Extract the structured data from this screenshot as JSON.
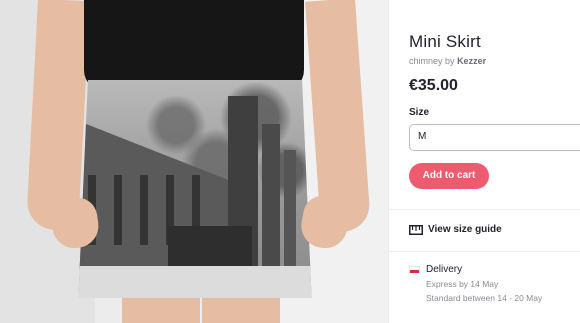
{
  "product": {
    "title": "Mini Skirt",
    "design_name": "chimney",
    "by_label": "by",
    "artist": "Kezzer",
    "price": "€35.00"
  },
  "size": {
    "label": "Size",
    "selected": "M"
  },
  "actions": {
    "add_to_cart": "Add to cart",
    "size_guide": "View size guide"
  },
  "delivery": {
    "title": "Delivery",
    "express": "Express by 14 May",
    "standard": "Standard between 14 - 20 May",
    "flag_icon": "poland-flag-icon"
  },
  "colors": {
    "accent": "#ef5b6e",
    "text": "#22222e",
    "muted": "#8a8a95"
  }
}
